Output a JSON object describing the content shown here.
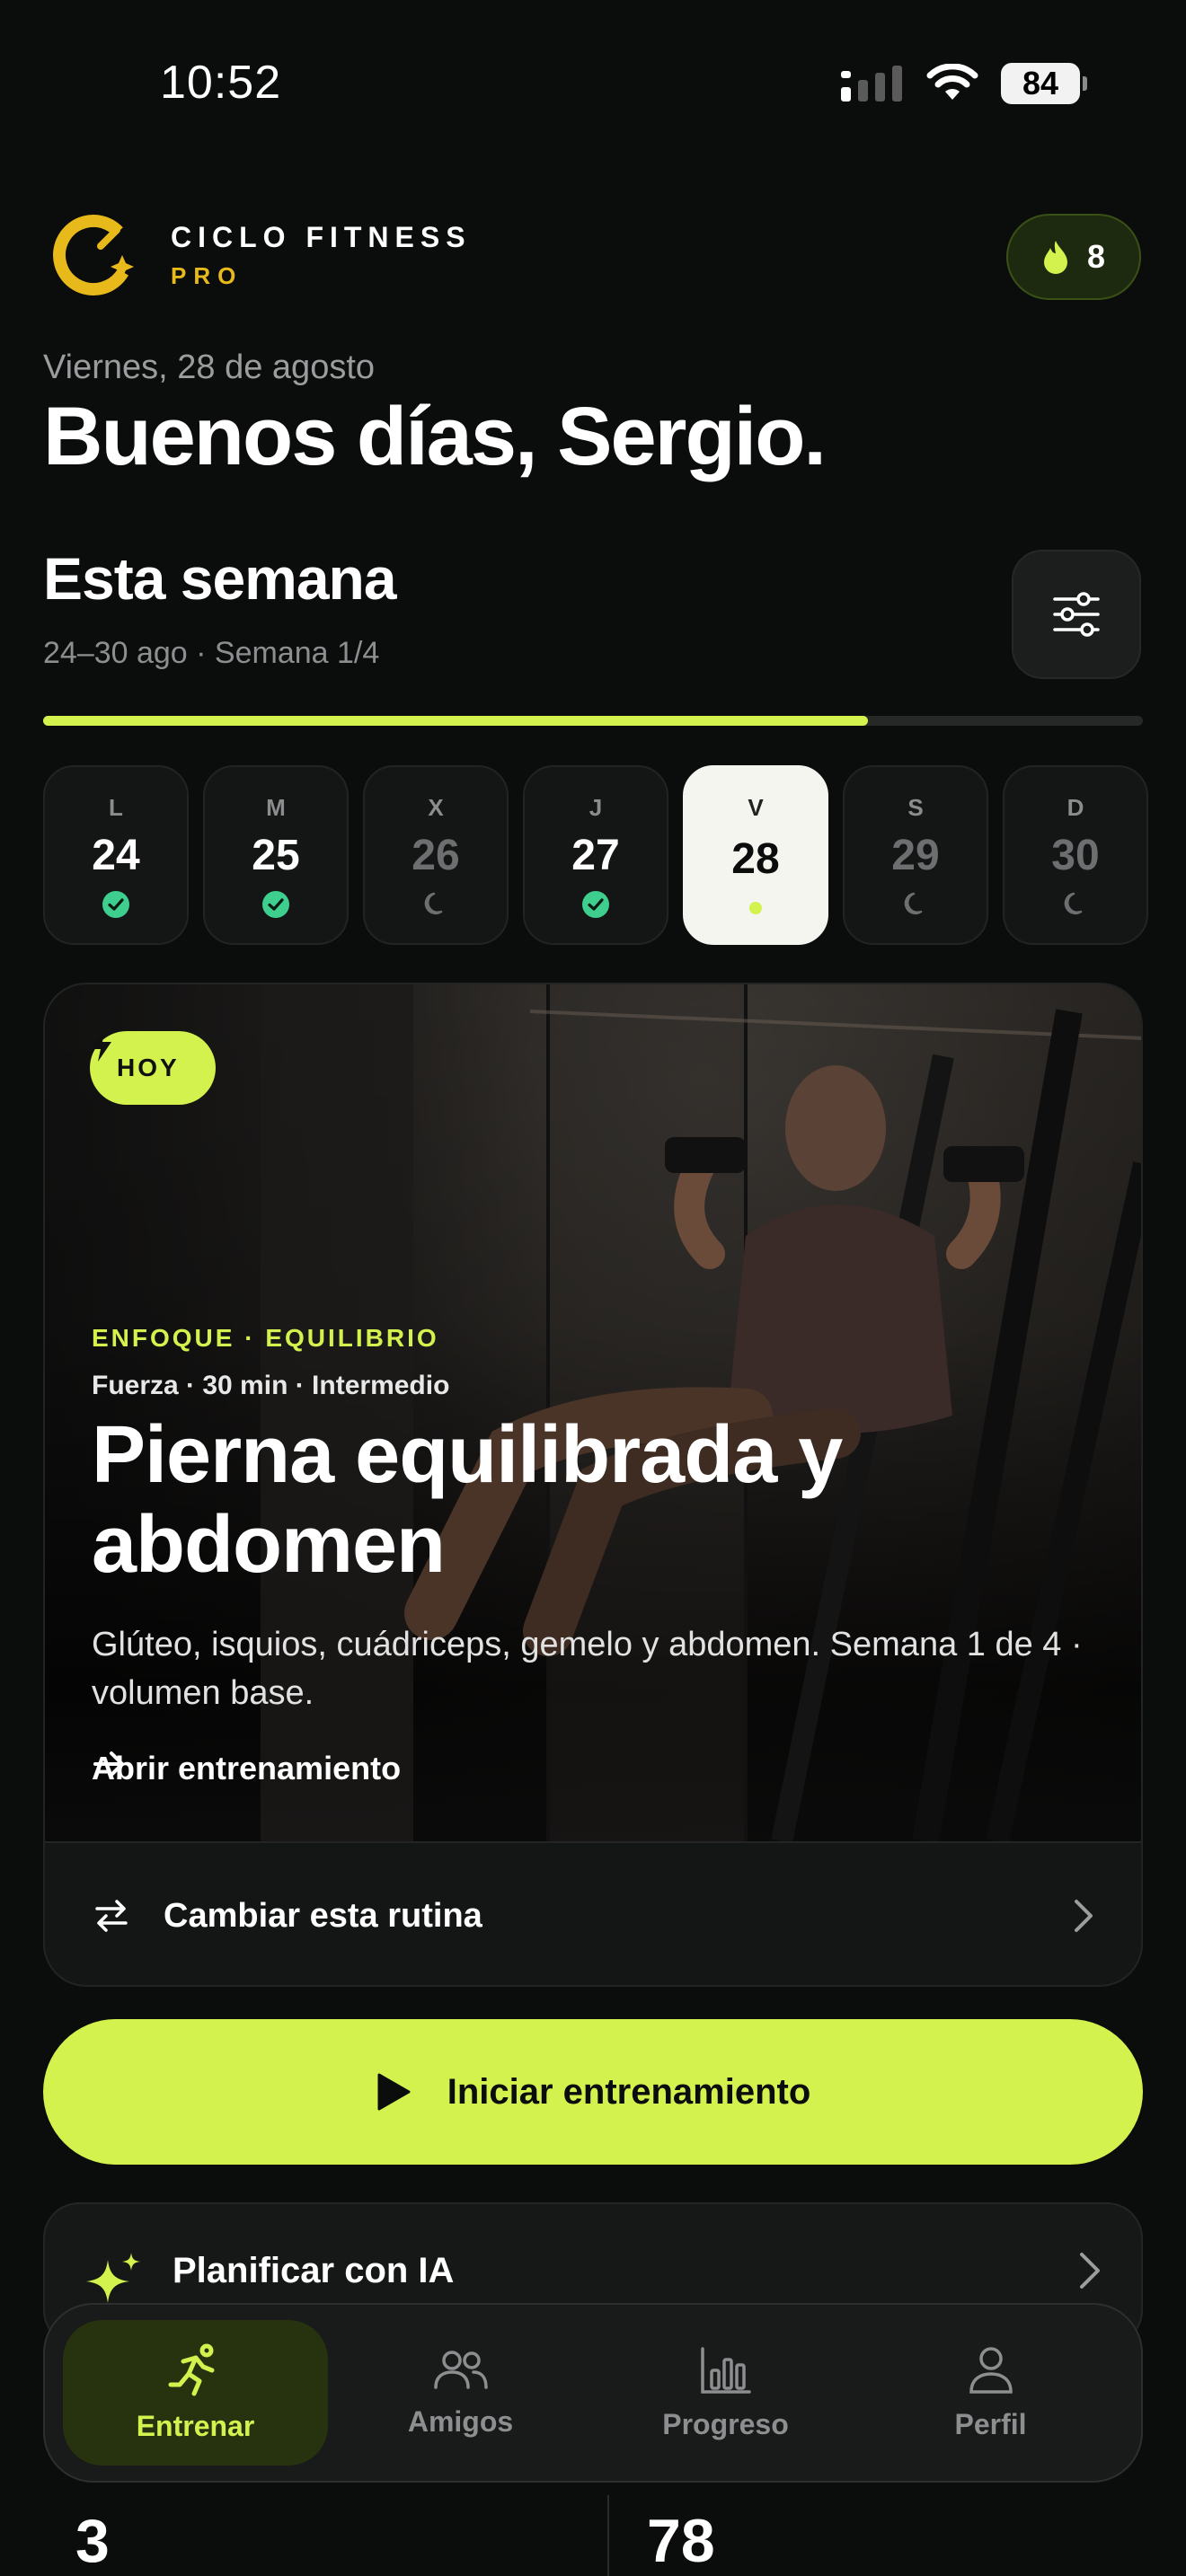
{
  "status_bar": {
    "time": "10:52",
    "battery": "84"
  },
  "header": {
    "brand": "CICLO FITNESS",
    "brand_sub": "PRO",
    "streak": "8"
  },
  "date": "Viernes, 28 de agosto",
  "greeting": "Buenos días, Sergio.",
  "week": {
    "title": "Esta semana",
    "subtitle": "24–30 ago · Semana 1/4",
    "progress": 0.75,
    "days": [
      {
        "letter": "L",
        "num": "24",
        "state": "done"
      },
      {
        "letter": "M",
        "num": "25",
        "state": "done"
      },
      {
        "letter": "X",
        "num": "26",
        "state": "rest"
      },
      {
        "letter": "J",
        "num": "27",
        "state": "done"
      },
      {
        "letter": "V",
        "num": "28",
        "state": "today"
      },
      {
        "letter": "S",
        "num": "29",
        "state": "rest"
      },
      {
        "letter": "D",
        "num": "30",
        "state": "rest"
      }
    ]
  },
  "workout": {
    "badge": "HOY",
    "focus": "ENFOQUE · EQUILIBRIO",
    "meta": "Fuerza · 30 min · Intermedio",
    "title": "Pierna equilibrada y abdomen",
    "description": "Glúteo, isquios, cuádriceps, gemelo y abdomen. Semana 1 de 4 · volumen base.",
    "open_label": "Abrir entrenamiento",
    "change_label": "Cambiar esta rutina"
  },
  "start_label": "Iniciar entrenamiento",
  "ai_label": "Planificar con IA",
  "nav": {
    "items": [
      {
        "label": "Entrenar",
        "icon": "runner-icon",
        "active": true
      },
      {
        "label": "Amigos",
        "icon": "friends-icon",
        "active": false
      },
      {
        "label": "Progreso",
        "icon": "chart-icon",
        "active": false
      },
      {
        "label": "Perfil",
        "icon": "profile-icon",
        "active": false
      }
    ]
  },
  "stats": {
    "left": "3",
    "right": "78"
  },
  "colors": {
    "accent": "#d3f24d",
    "gold": "#e8b91a",
    "done": "#3ecf8e",
    "background": "#0b0c0c"
  }
}
